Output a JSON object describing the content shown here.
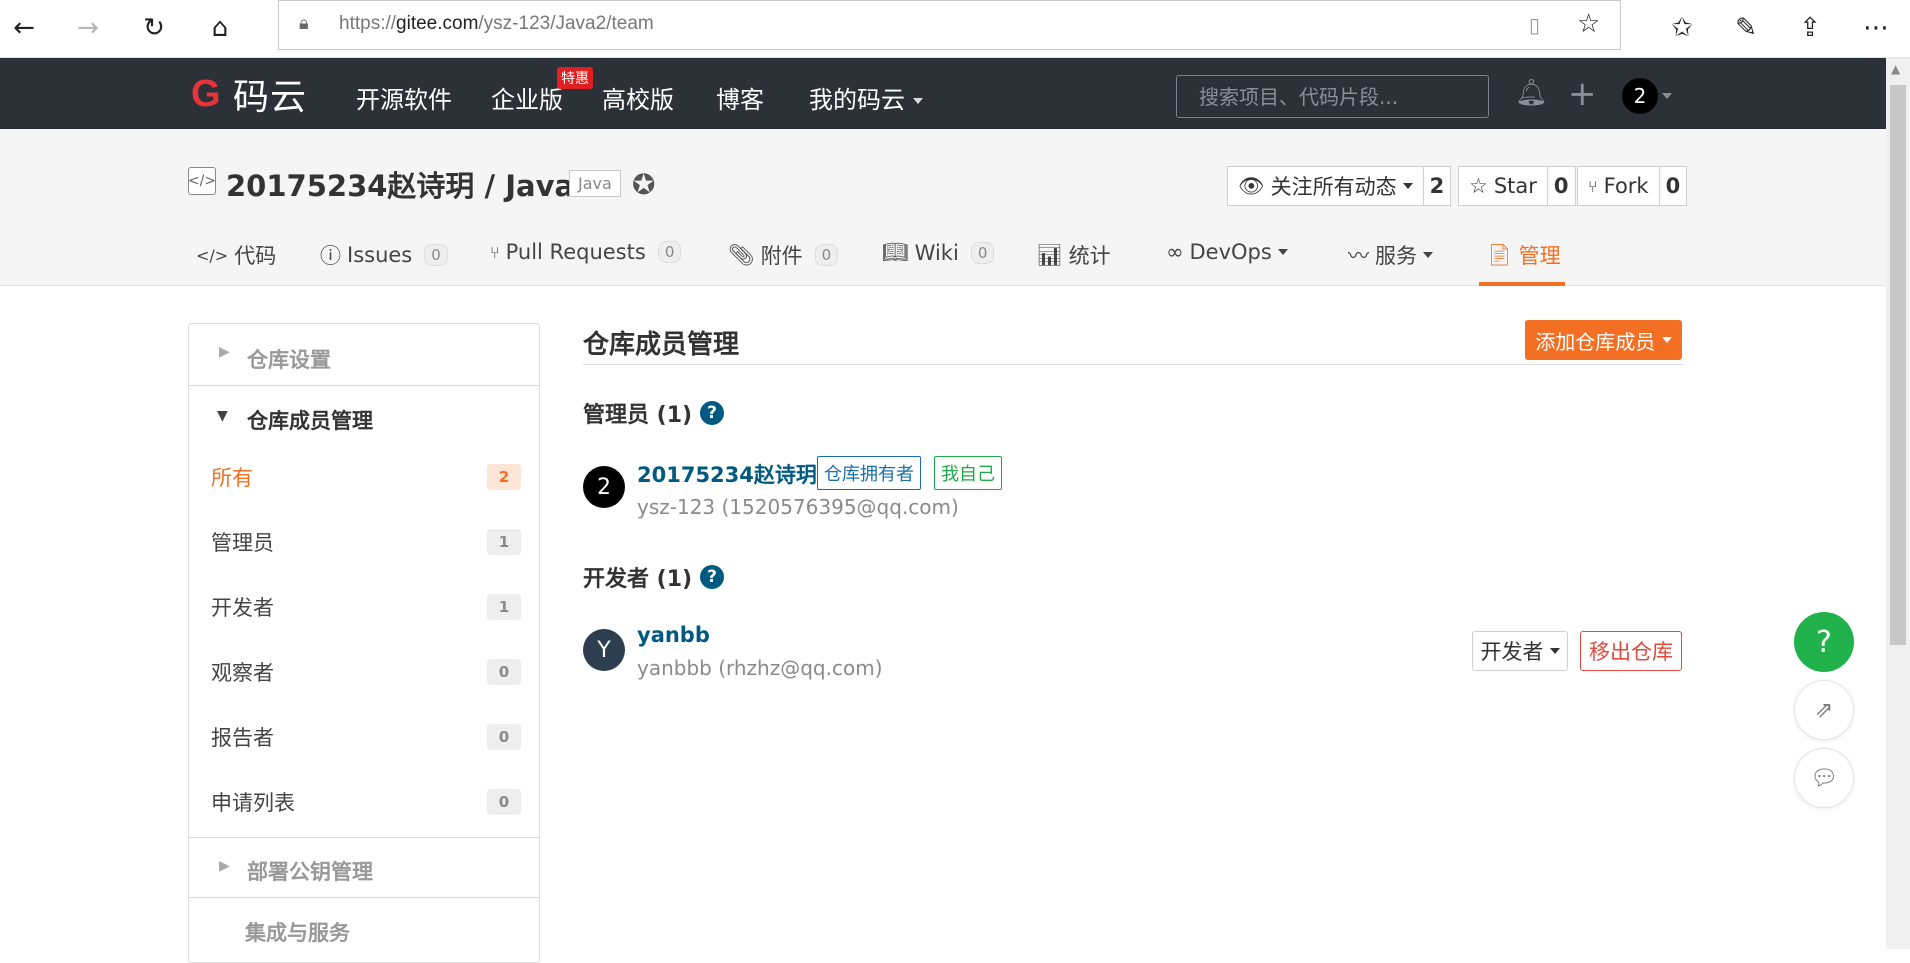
{
  "browser": {
    "url_prefix": "https://",
    "url_host": "gitee.com",
    "url_path": "/ysz-123/Java2/team"
  },
  "topnav": {
    "logo_text": "码云",
    "links": [
      "开源软件",
      "企业版",
      "高校版",
      "博客",
      "我的码云"
    ],
    "hot_badge": "特惠",
    "search_placeholder": "搜索项目、代码片段...",
    "avatar_letter": "2"
  },
  "repo": {
    "title": "20175234赵诗玥 / Java2",
    "language": "Java",
    "watch_label": "关注所有动态",
    "watch_count": "2",
    "star_label": "Star",
    "star_count": "0",
    "fork_label": "Fork",
    "fork_count": "0"
  },
  "tabs": [
    {
      "label": "代码"
    },
    {
      "label": "Issues",
      "count": "0"
    },
    {
      "label": "Pull Requests",
      "count": "0"
    },
    {
      "label": "附件",
      "count": "0"
    },
    {
      "label": "Wiki",
      "count": "0"
    },
    {
      "label": "统计"
    },
    {
      "label": "DevOps"
    },
    {
      "label": "服务"
    },
    {
      "label": "管理"
    }
  ],
  "sidebar": {
    "section_repo_settings": "仓库设置",
    "section_members": "仓库成员管理",
    "items": [
      {
        "label": "所有",
        "count": "2"
      },
      {
        "label": "管理员",
        "count": "1"
      },
      {
        "label": "开发者",
        "count": "1"
      },
      {
        "label": "观察者",
        "count": "0"
      },
      {
        "label": "报告者",
        "count": "0"
      },
      {
        "label": "申请列表",
        "count": "0"
      }
    ],
    "section_deploy_keys": "部署公钥管理",
    "section_integrations": "集成与服务"
  },
  "main": {
    "title": "仓库成员管理",
    "add_button": "添加仓库成员",
    "admins_title": "管理员 (1)",
    "developers_title": "开发者 (1)",
    "admin": {
      "avatar": "2",
      "name": "20175234赵诗玥",
      "tag_owner": "仓库拥有者",
      "tag_self": "我自己",
      "sub": "ysz-123 (1520576395@qq.com)"
    },
    "developer": {
      "avatar": "Y",
      "name": "yanbb",
      "sub": "yanbbb (rhzhz@qq.com)",
      "role": "开发者",
      "remove": "移出仓库"
    }
  },
  "colors": {
    "accent": "#f36f23",
    "nav_bg": "#2c3037",
    "link": "#005980",
    "danger": "#e04a3d",
    "success": "#22b24c"
  }
}
